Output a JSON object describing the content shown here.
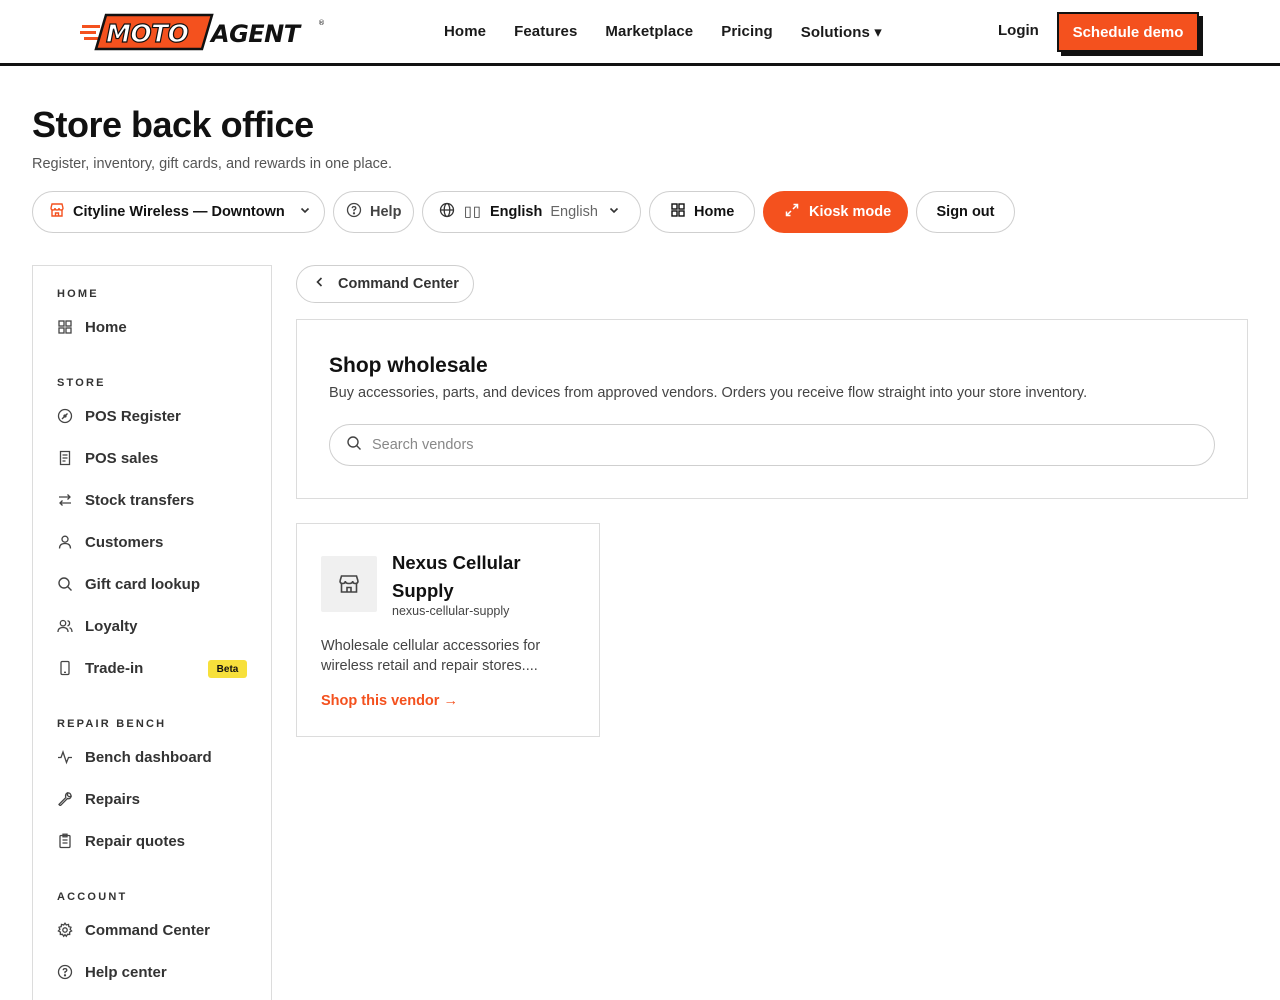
{
  "brand": {
    "logo_part1": "MOTO",
    "logo_part2": "AGENT",
    "trademark": "®",
    "accent_color": "#f4511e",
    "beta_color": "#f7e03b"
  },
  "topnav": {
    "links": [
      {
        "label": "Home"
      },
      {
        "label": "Features"
      },
      {
        "label": "Marketplace"
      },
      {
        "label": "Pricing"
      },
      {
        "label": "Solutions ▾"
      }
    ],
    "login_label": "Login",
    "demo_label": "Schedule demo"
  },
  "header": {
    "title": "Store back office",
    "subtitle": "Register, inventory, gift cards, and rewards in one place."
  },
  "toolbar": {
    "store_name": "Cityline Wireless — Downtown",
    "store_icon": "store-icon",
    "help_label": "Help",
    "language_flag": "▯▯",
    "language_label": "English",
    "language_selected": "English",
    "home_label": "Home",
    "kiosk_label": "Kiosk mode",
    "signout_label": "Sign out"
  },
  "sidebar": {
    "sections": {
      "home": "HOME",
      "store": "STORE",
      "repair": "REPAIR BENCH",
      "account": "ACCOUNT"
    },
    "items": {
      "home": {
        "label": "Home",
        "icon": "grid-icon"
      },
      "pos_register": {
        "label": "POS Register",
        "icon": "gauge-icon"
      },
      "pos_sales": {
        "label": "POS sales",
        "icon": "receipt-icon"
      },
      "stock_transfers": {
        "label": "Stock transfers",
        "icon": "arrows-swap-icon"
      },
      "customers": {
        "label": "Customers",
        "icon": "user-icon"
      },
      "gift_card_lookup": {
        "label": "Gift card lookup",
        "icon": "search-icon"
      },
      "loyalty": {
        "label": "Loyalty",
        "icon": "users-icon"
      },
      "trade_in": {
        "label": "Trade-in",
        "icon": "phone-icon",
        "badge": "Beta"
      },
      "bench_dashboard": {
        "label": "Bench dashboard",
        "icon": "activity-icon"
      },
      "repairs": {
        "label": "Repairs",
        "icon": "wrench-icon"
      },
      "repair_quotes": {
        "label": "Repair quotes",
        "icon": "clipboard-icon"
      },
      "command_center": {
        "label": "Command Center",
        "icon": "gear-icon"
      },
      "help_center": {
        "label": "Help center",
        "icon": "help-circle-icon"
      }
    }
  },
  "main": {
    "back_label": "Command Center",
    "wholesale": {
      "title": "Shop wholesale",
      "description": "Buy accessories, parts, and devices from approved vendors. Orders you receive flow straight into your store inventory.",
      "search_placeholder": "Search vendors"
    },
    "vendors": [
      {
        "name": "Nexus Cellular Supply",
        "slug": "nexus-cellular-supply",
        "description": "Wholesale cellular accessories for wireless retail and repair stores....",
        "link_label": "Shop this vendor →",
        "icon": "storefront-icon"
      }
    ]
  }
}
